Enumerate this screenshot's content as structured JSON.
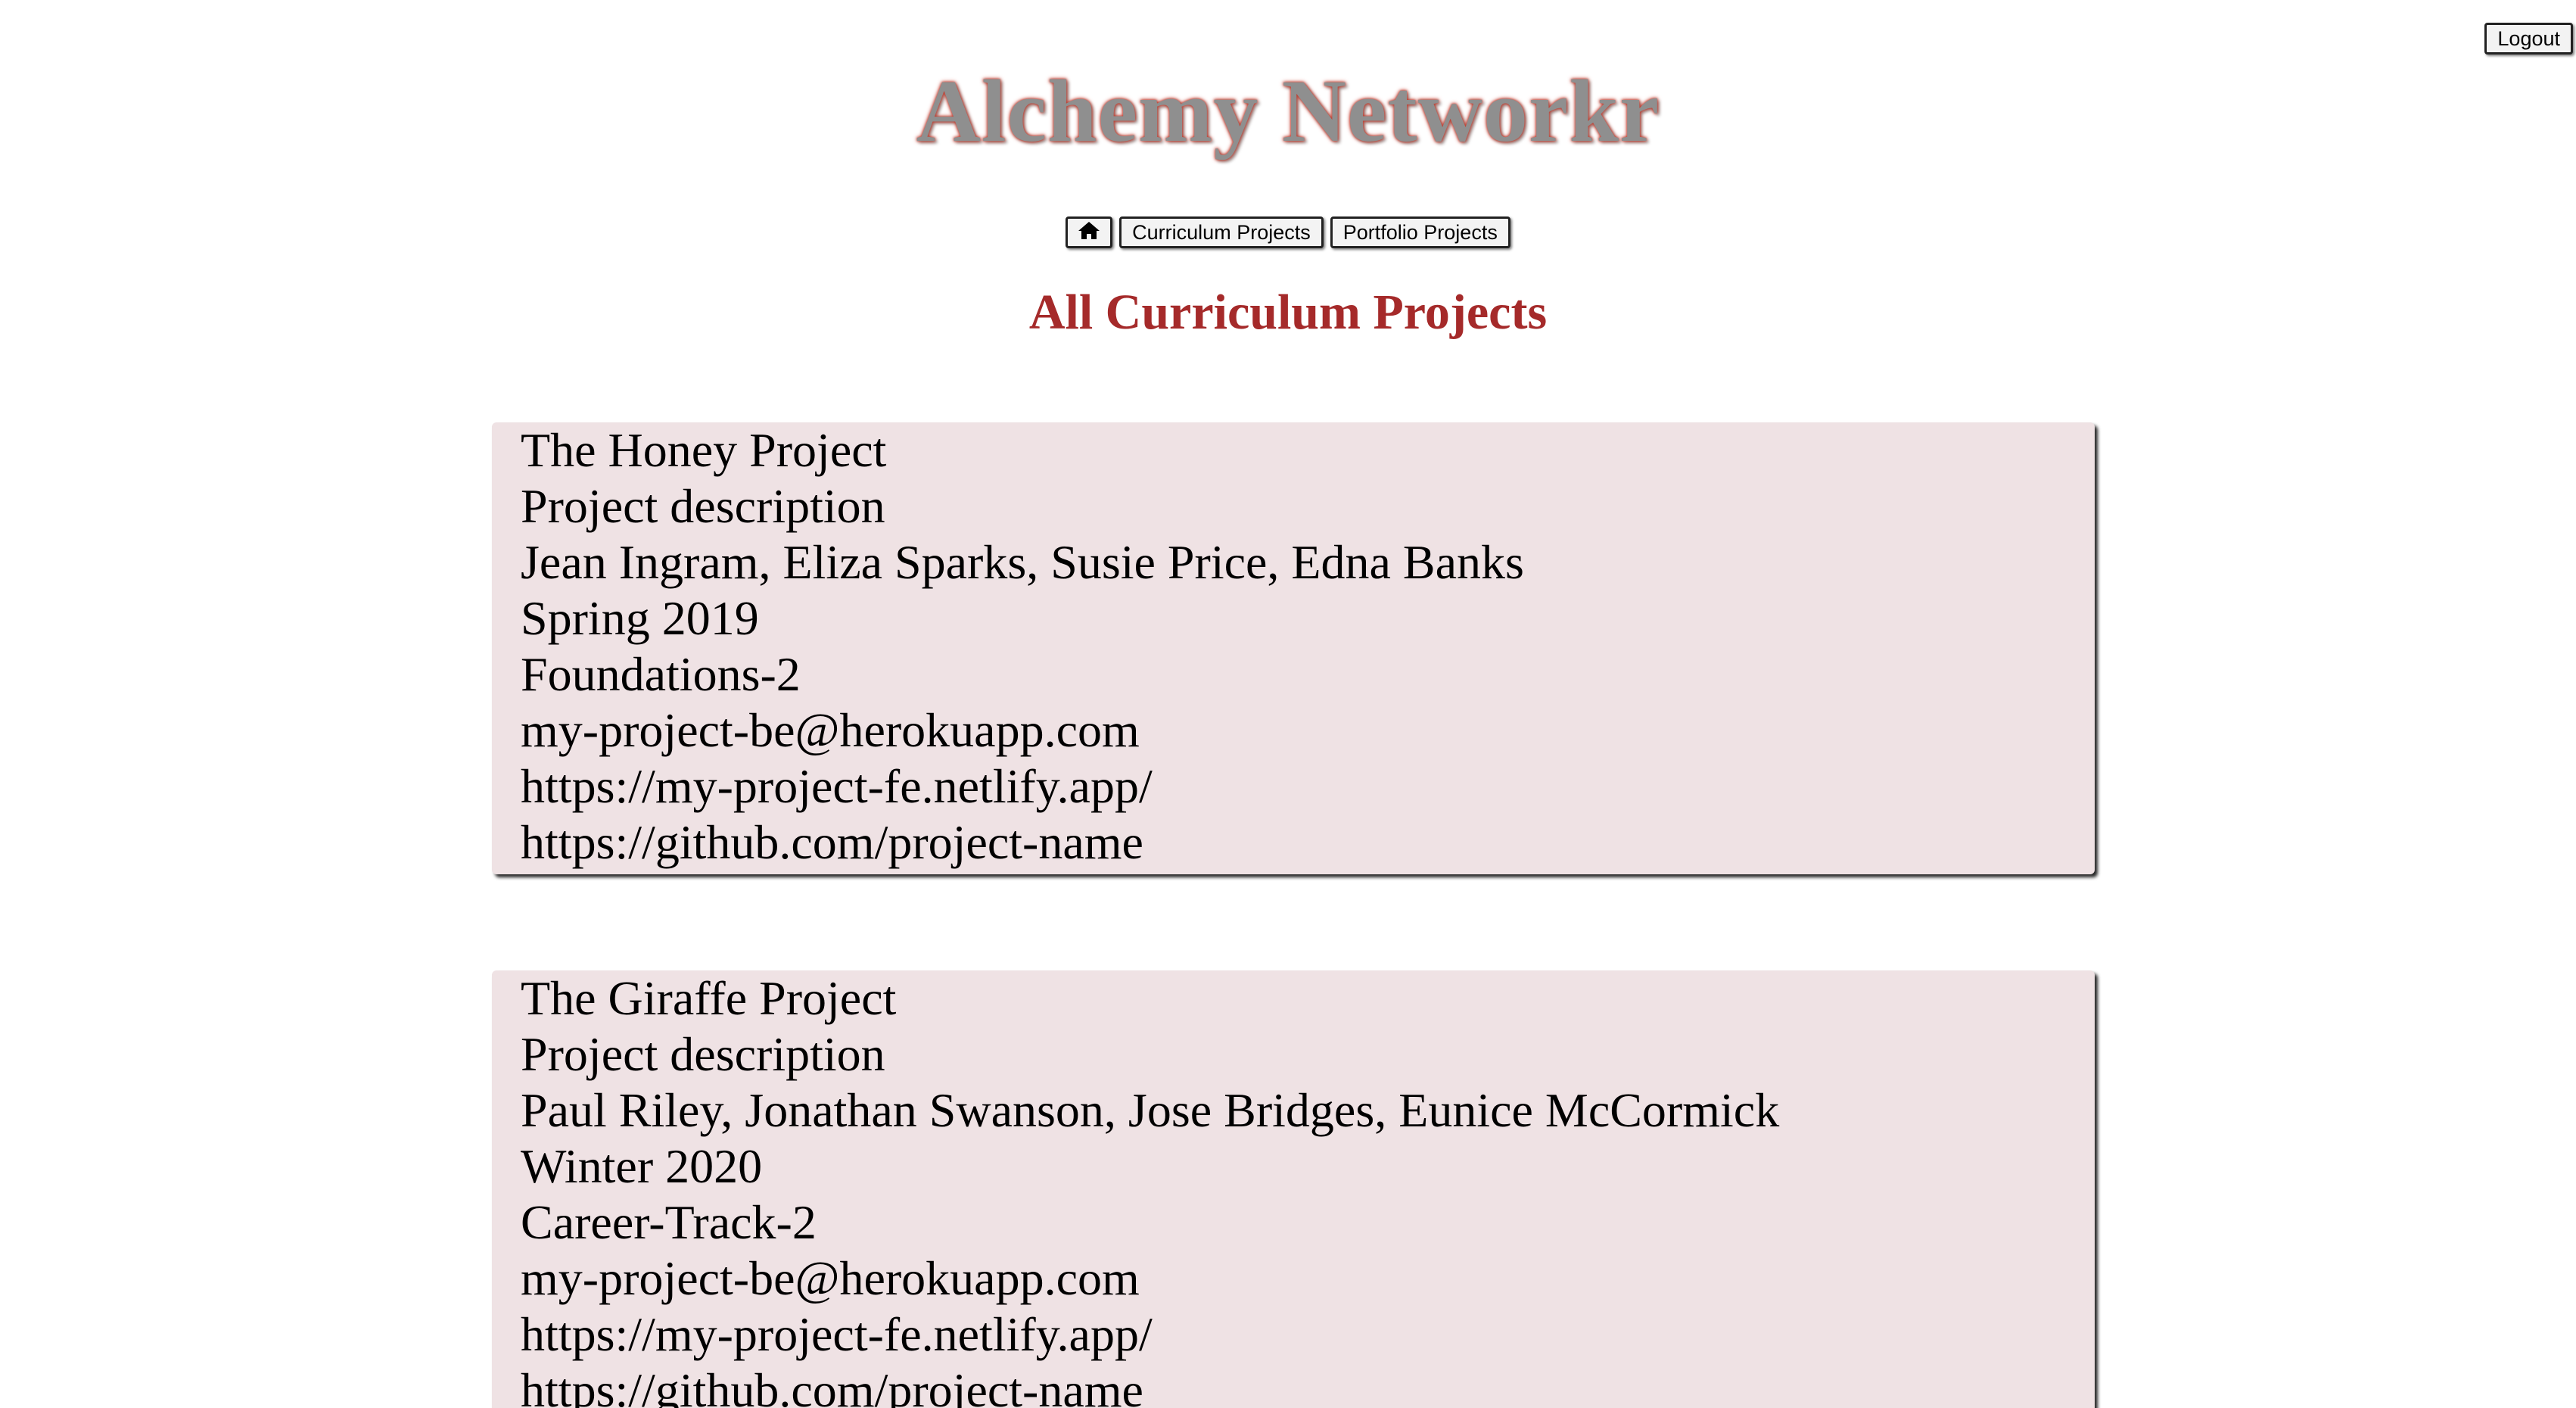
{
  "header": {
    "title": "Alchemy Networkr",
    "logout_label": "Logout"
  },
  "nav": {
    "home_icon": "home-icon",
    "curriculum_label": "Curriculum Projects",
    "portfolio_label": "Portfolio Projects"
  },
  "page": {
    "heading": "All Curriculum Projects"
  },
  "projects": [
    {
      "title": "The Honey Project",
      "description": "Project description",
      "members": "Jean Ingram, Eliza Sparks, Susie Price, Edna Banks",
      "cohort": "Spring 2019",
      "track": "Foundations-2",
      "backend": "my-project-be@herokuapp.com",
      "frontend": "https://my-project-fe.netlify.app/",
      "github": "https://github.com/project-name"
    },
    {
      "title": "The Giraffe Project",
      "description": "Project description",
      "members": "Paul Riley, Jonathan Swanson, Jose Bridges, Eunice McCormick",
      "cohort": "Winter 2020",
      "track": "Career-Track-2",
      "backend": "my-project-be@herokuapp.com",
      "frontend": "https://my-project-fe.netlify.app/",
      "github": "https://github.com/project-name"
    }
  ],
  "colors": {
    "heading": "#a52a2a",
    "card_background": "#efe2e4",
    "title_text": "#8f8f8f",
    "title_glow": "#c0392b"
  }
}
